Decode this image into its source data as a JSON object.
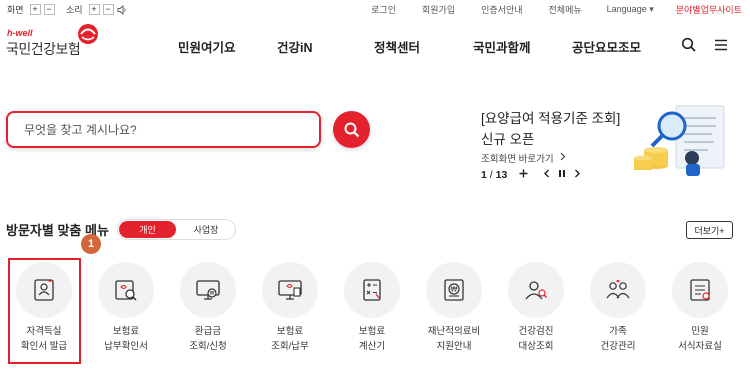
{
  "utility": {
    "screen_label": "화면",
    "sound_label": "소리",
    "plus": "+",
    "minus": "−",
    "links": [
      "로그인",
      "회원가입",
      "인증서안내",
      "전체메뉴"
    ],
    "language": "Language",
    "business_site": "분야별업무사이트"
  },
  "logo": {
    "tagline": "h-well",
    "name": "국민건강보험"
  },
  "nav": {
    "items": [
      "민원여기요",
      "건강iN",
      "정책센터",
      "국민과함께",
      "공단요모조모"
    ]
  },
  "search": {
    "placeholder": "무엇을 찾고 계시나요?"
  },
  "notice": {
    "title": "[요양급여 적용기준 조회]",
    "subtitle": "신규 오픈",
    "link": "조회화면 바로가기",
    "page_current": "1",
    "page_total": "13",
    "page_sep": " / "
  },
  "menu_section": {
    "title": "방문자별 맞춤 메뉴",
    "tab_personal": "개인",
    "tab_business": "사업장",
    "more": "더보기+",
    "badge": "1",
    "items": [
      {
        "line1": "자격득실",
        "line2": "확인서 발급",
        "icon": "id-card-icon"
      },
      {
        "line1": "보험료",
        "line2": "납부확인서",
        "icon": "document-search-icon"
      },
      {
        "line1": "환급금",
        "line2": "조회/신청",
        "icon": "monitor-refund-icon"
      },
      {
        "line1": "보험료",
        "line2": "조회/납부",
        "icon": "monitor-payment-icon"
      },
      {
        "line1": "보험료",
        "line2": "계산기",
        "icon": "calculator-icon"
      },
      {
        "line1": "재난적의료비",
        "line2": "지원안내",
        "icon": "document-won-icon"
      },
      {
        "line1": "건강검진",
        "line2": "대상조회",
        "icon": "person-search-icon"
      },
      {
        "line1": "가족",
        "line2": "건강관리",
        "icon": "family-icon"
      },
      {
        "line1": "민원",
        "line2": "서식자료실",
        "icon": "form-document-icon"
      }
    ]
  },
  "colors": {
    "brand": "#e3222d",
    "badge": "#d4663a"
  }
}
